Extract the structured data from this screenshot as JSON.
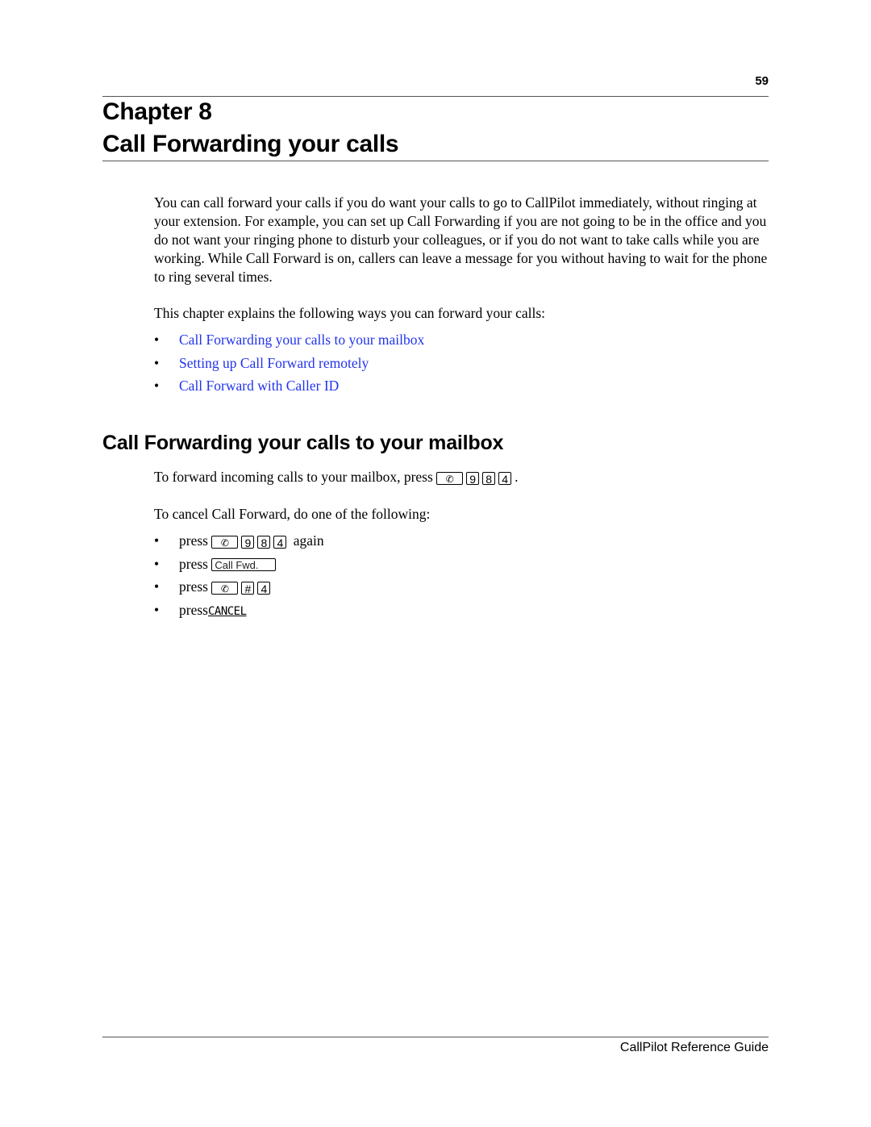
{
  "page_number": "59",
  "chapter": {
    "line1": "Chapter 8",
    "line2": "Call Forwarding your calls"
  },
  "intro_paragraph": "You can call forward your calls if you do want your calls to go to CallPilot immediately, without ringing at your extension. For example, you can set up Call Forwarding if you are not going to be in the office and you do not want your ringing phone to disturb your colleagues, or if you do not want to take calls while you are working. While Call Forward is on, callers can leave a message for you without having to wait for the phone to ring several times.",
  "explain_line": "This chapter explains the following ways you can forward your calls:",
  "bullet_glyph": "•",
  "toc_links": [
    {
      "label": "Call Forwarding your calls to your mailbox"
    },
    {
      "label": "Setting up Call Forward remotely"
    },
    {
      "label": "Call Forward with Caller ID"
    }
  ],
  "link_color": "#2233ee",
  "section": {
    "heading": "Call Forwarding your calls to your mailbox",
    "forward_text": "To forward incoming calls to your mailbox, press",
    "forward_keys": {
      "feature": "✆",
      "k1": "9",
      "k2": "8",
      "k3": "4"
    },
    "forward_end": ".",
    "cancel_intro": "To cancel Call Forward, do one of the following:",
    "cancel_options": {
      "press_word": "press",
      "option1": {
        "feature": "✆",
        "k1": "9",
        "k2": "8",
        "k3": "4",
        "suffix": "again"
      },
      "option2": {
        "softkey": "Call Fwd."
      },
      "option3": {
        "feature": "✆",
        "k1": "#",
        "k2": "4"
      },
      "option4": {
        "display_key": "CANCEL"
      }
    }
  },
  "footer": "CallPilot Reference Guide"
}
